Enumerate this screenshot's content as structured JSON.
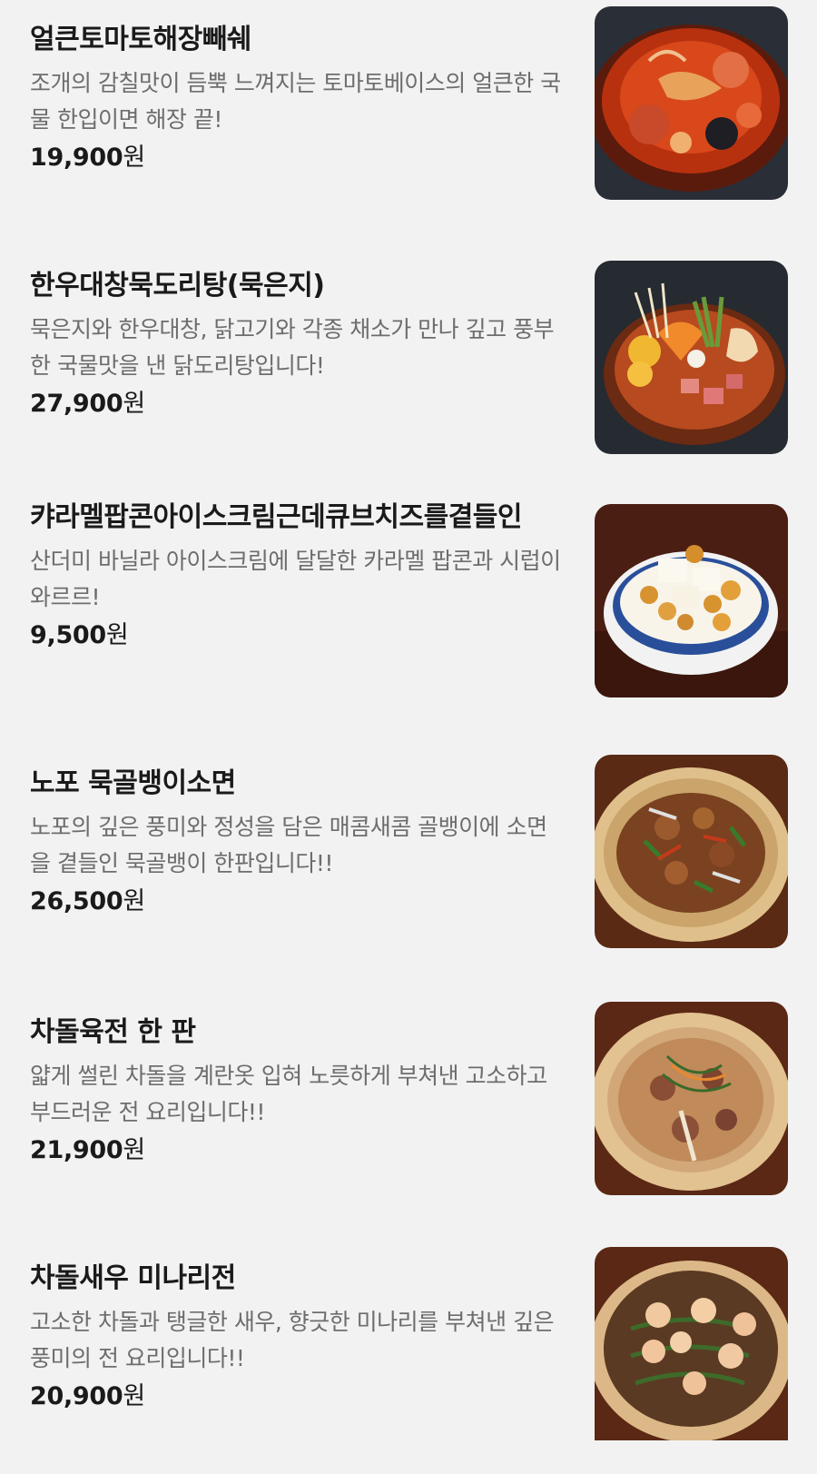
{
  "menu": {
    "items": [
      {
        "name": "얼큰토마토해장빼쉐",
        "description": "조개의 감칠맛이 듬뿍 느껴지는 토마토베이스의 얼큰한 국물 한입이면 해장 끝!",
        "price": "19,900",
        "currency": "원",
        "image_icon": "tomato-seafood-stew-photo"
      },
      {
        "name": "한우대창묵도리탕(묵은지)",
        "description": "묵은지와 한우대창, 닭고기와 각종 채소가 만나 깊고 풍부한 국물맛을 낸 닭도리탕입니다!",
        "price": "27,900",
        "currency": "원",
        "image_icon": "braised-chicken-stew-photo"
      },
      {
        "name": "캬라멜팝콘아이스크림근데큐브치즈를곁들인",
        "description": "산더미 바닐라 아이스크림에 달달한 카라멜 팝콘과 시럽이 와르르!",
        "price": "9,500",
        "currency": "원",
        "image_icon": "popcorn-ice-cream-photo"
      },
      {
        "name": "노포 묵골뱅이소면",
        "description": "노포의 깊은 풍미와 정성을 담은 매콤새콤 골뱅이에 소면을 곁들인 묵골뱅이 한판입니다!!",
        "price": "26,500",
        "currency": "원",
        "image_icon": "sea-snail-noodle-photo"
      },
      {
        "name": "차돌육전 한 판",
        "description": "얇게 썰린 차돌을 계란옷 입혀 노릇하게 부쳐낸 고소하고 부드러운 전 요리입니다!!",
        "price": "21,900",
        "currency": "원",
        "image_icon": "beef-pancake-photo"
      },
      {
        "name": "차돌새우 미나리전",
        "description": "고소한 차돌과 탱글한 새우, 향긋한 미나리를 부쳐낸 깊은 풍미의 전 요리입니다!!",
        "price": "20,900",
        "currency": "원",
        "image_icon": "shrimp-minari-pancake-photo"
      }
    ]
  }
}
